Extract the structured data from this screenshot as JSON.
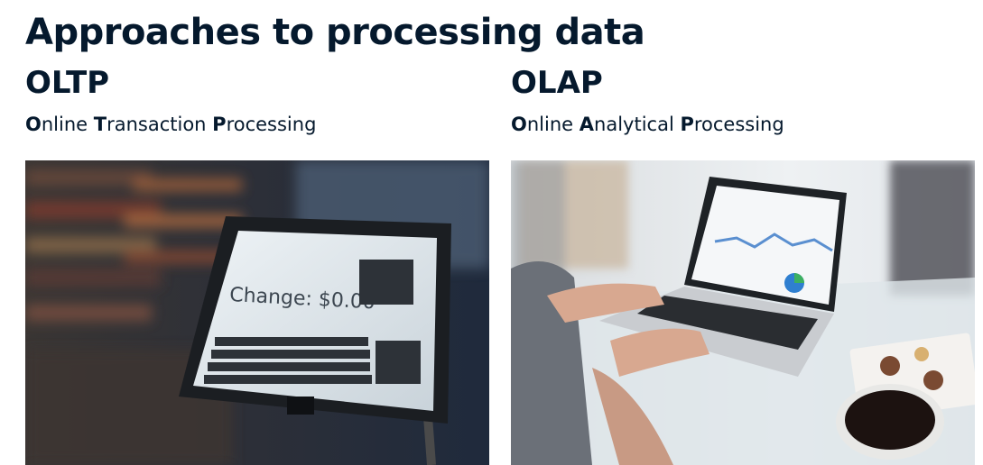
{
  "heading": "Approaches to processing data",
  "oltp": {
    "abbr": "OLTP",
    "full_name_parts": [
      {
        "text": "O",
        "bold": true
      },
      {
        "text": "nline ",
        "bold": false
      },
      {
        "text": "T",
        "bold": true
      },
      {
        "text": "ransaction ",
        "bold": false
      },
      {
        "text": "P",
        "bold": true
      },
      {
        "text": "rocessing",
        "bold": false
      }
    ],
    "photo": {
      "screen_text": "Change: $0.00",
      "subject": "point-of-sale terminal"
    }
  },
  "olap": {
    "abbr": "OLAP",
    "full_name_parts": [
      {
        "text": "O",
        "bold": true
      },
      {
        "text": "nline ",
        "bold": false
      },
      {
        "text": "A",
        "bold": true
      },
      {
        "text": "nalytical ",
        "bold": false
      },
      {
        "text": "P",
        "bold": true
      },
      {
        "text": "rocessing",
        "bold": false
      }
    ],
    "photo": {
      "subject": "laptop showing analytics dashboard"
    }
  },
  "colors": {
    "text": "#05192d",
    "pos_frame": "#1b1e22",
    "pos_screen": "#dfe7ec",
    "laptop_body": "#c9ccd0"
  }
}
